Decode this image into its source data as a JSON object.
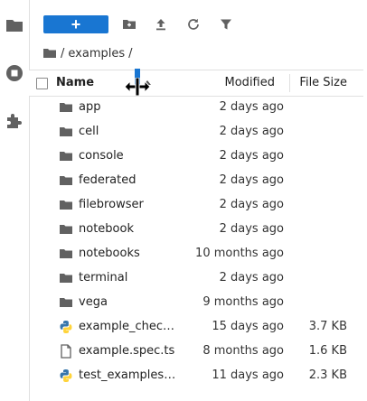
{
  "toolbar": {
    "new_label": "+",
    "new_folder_icon": "new-folder-icon",
    "upload_icon": "upload-icon",
    "refresh_icon": "refresh-icon",
    "filter_icon": "filter-icon"
  },
  "breadcrumb": {
    "root": "/",
    "segment": "examples",
    "trailing": "/"
  },
  "header": {
    "name": "Name",
    "modified": "Modified",
    "file_size": "File Size"
  },
  "files": [
    {
      "name": "app",
      "modified": "2 days ago",
      "size": "",
      "kind": "folder"
    },
    {
      "name": "cell",
      "modified": "2 days ago",
      "size": "",
      "kind": "folder"
    },
    {
      "name": "console",
      "modified": "2 days ago",
      "size": "",
      "kind": "folder"
    },
    {
      "name": "federated",
      "modified": "2 days ago",
      "size": "",
      "kind": "folder"
    },
    {
      "name": "filebrowser",
      "modified": "2 days ago",
      "size": "",
      "kind": "folder"
    },
    {
      "name": "notebook",
      "modified": "2 days ago",
      "size": "",
      "kind": "folder"
    },
    {
      "name": "notebooks",
      "modified": "10 months ago",
      "size": "",
      "kind": "folder"
    },
    {
      "name": "terminal",
      "modified": "2 days ago",
      "size": "",
      "kind": "folder"
    },
    {
      "name": "vega",
      "modified": "9 months ago",
      "size": "",
      "kind": "folder"
    },
    {
      "name": "example_chec…",
      "modified": "15 days ago",
      "size": "3.7 KB",
      "kind": "python"
    },
    {
      "name": "example.spec.ts",
      "modified": "8 months ago",
      "size": "1.6 KB",
      "kind": "file"
    },
    {
      "name": "test_examples…",
      "modified": "11 days ago",
      "size": "2.3 KB",
      "kind": "python"
    }
  ],
  "colors": {
    "accent": "#1976d2",
    "icon": "#616161",
    "python_blue": "#3776ab",
    "python_yellow": "#ffd43b"
  }
}
